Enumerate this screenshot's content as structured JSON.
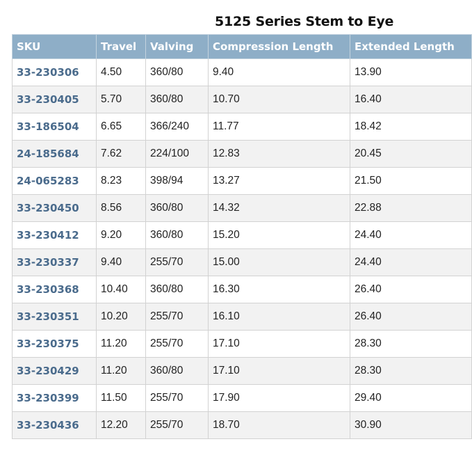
{
  "title": "5125 Series Stem to Eye",
  "columns": [
    "SKU",
    "Travel",
    "Valving",
    "Compression Length",
    "Extended Length"
  ],
  "rows": [
    [
      "33-230306",
      "4.50",
      "360/80",
      "9.40",
      "13.90"
    ],
    [
      "33-230405",
      "5.70",
      "360/80",
      "10.70",
      "16.40"
    ],
    [
      "33-186504",
      "6.65",
      "366/240",
      "11.77",
      "18.42"
    ],
    [
      "24-185684",
      "7.62",
      "224/100",
      "12.83",
      "20.45"
    ],
    [
      "24-065283",
      "8.23",
      "398/94",
      "13.27",
      "21.50"
    ],
    [
      "33-230450",
      "8.56",
      "360/80",
      "14.32",
      "22.88"
    ],
    [
      "33-230412",
      "9.20",
      "360/80",
      "15.20",
      "24.40"
    ],
    [
      "33-230337",
      "9.40",
      "255/70",
      "15.00",
      "24.40"
    ],
    [
      "33-230368",
      "10.40",
      "360/80",
      "16.30",
      "26.40"
    ],
    [
      "33-230351",
      "10.20",
      "255/70",
      "16.10",
      "26.40"
    ],
    [
      "33-230375",
      "11.20",
      "255/70",
      "17.10",
      "28.30"
    ],
    [
      "33-230429",
      "11.20",
      "360/80",
      "17.10",
      "28.30"
    ],
    [
      "33-230399",
      "11.50",
      "255/70",
      "17.90",
      "29.40"
    ],
    [
      "33-230436",
      "12.20",
      "255/70",
      "18.70",
      "30.90"
    ]
  ],
  "colors": {
    "header_bg": "#8eaec7",
    "header_text": "#ffffff",
    "sku_link": "#4a6b8c",
    "row_alt_bg": "#f2f2f2"
  }
}
